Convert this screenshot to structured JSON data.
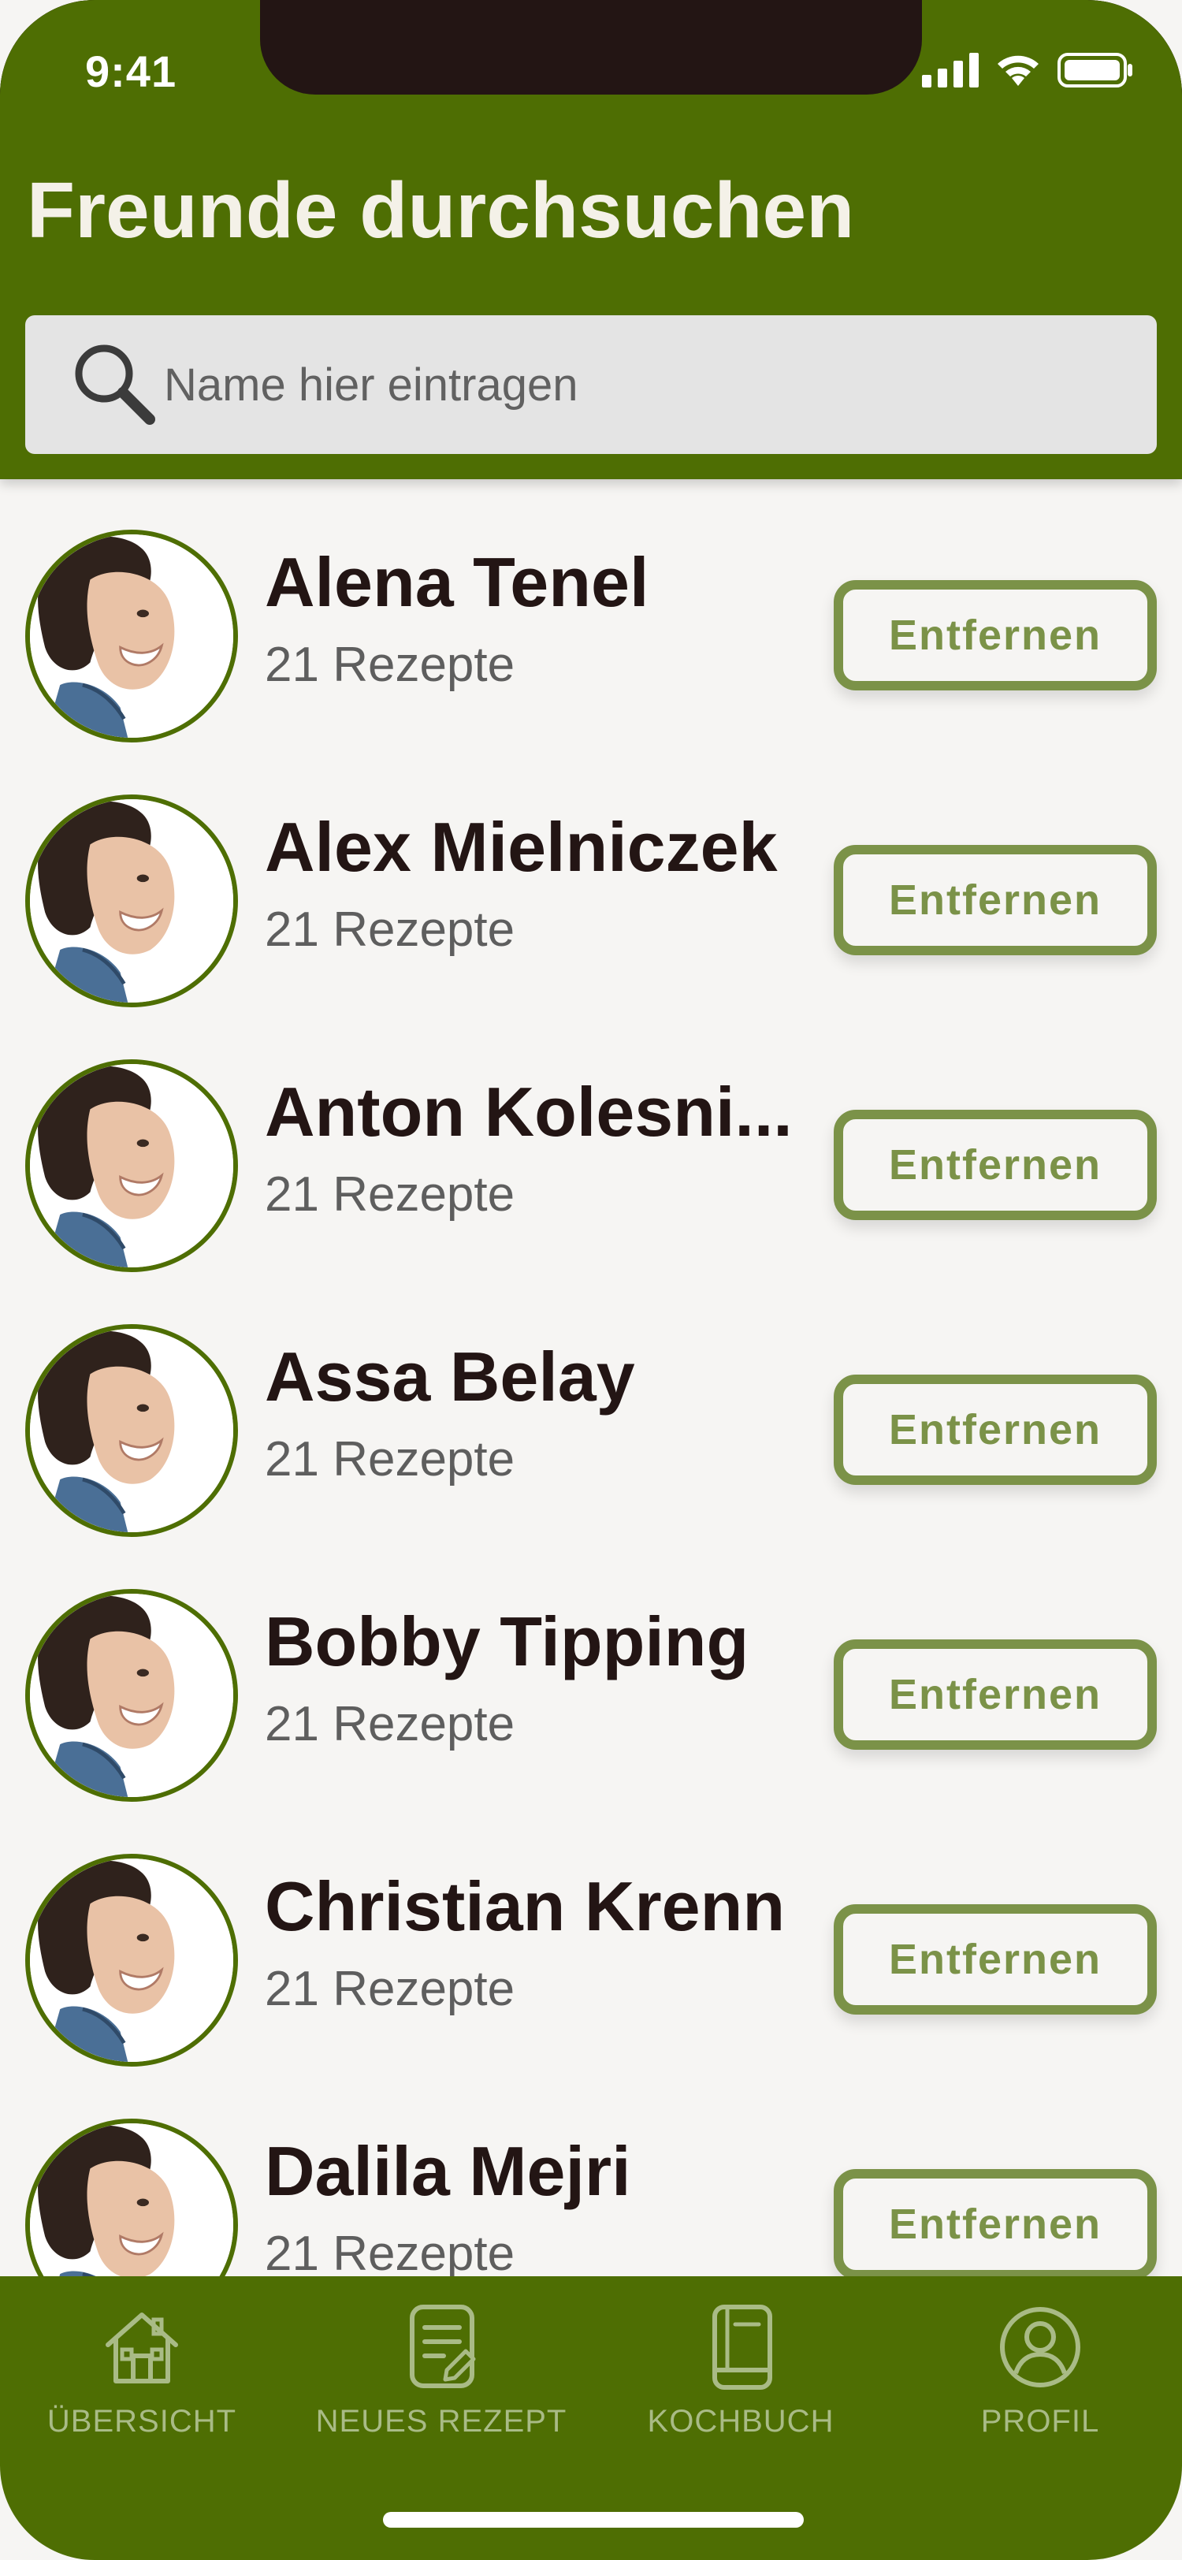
{
  "status_bar": {
    "time": "9:41"
  },
  "header": {
    "title": "Freunde durchsuchen"
  },
  "search": {
    "placeholder": "Name hier eintragen",
    "value": ""
  },
  "friends": [
    {
      "name": "Alena Tenel",
      "recipes": "21 Rezepte",
      "action": "Entfernen"
    },
    {
      "name": "Alex Mielniczek",
      "recipes": "21 Rezepte",
      "action": "Entfernen"
    },
    {
      "name": "Anton Kolesni...",
      "recipes": "21 Rezepte",
      "action": "Entfernen"
    },
    {
      "name": "Assa Belay",
      "recipes": "21 Rezepte",
      "action": "Entfernen"
    },
    {
      "name": "Bobby Tipping",
      "recipes": "21 Rezepte",
      "action": "Entfernen"
    },
    {
      "name": "Christian Krenn",
      "recipes": "21 Rezepte",
      "action": "Entfernen"
    },
    {
      "name": "Dalila Mejri",
      "recipes": "21 Rezepte",
      "action": "Entfernen"
    }
  ],
  "tab_bar": {
    "items": [
      {
        "label": "ÜBERSICHT",
        "icon": "house-icon"
      },
      {
        "label": "NEUES REZEPT",
        "icon": "note-edit-icon"
      },
      {
        "label": "KOCHBUCH",
        "icon": "book-icon"
      },
      {
        "label": "PROFIL",
        "icon": "profile-icon"
      }
    ]
  },
  "colors": {
    "brand_green": "#4e6e03",
    "button_green": "#7b9248",
    "tab_label": "#a9bb86",
    "background": "#f6f5f3",
    "text_dark": "#231514"
  }
}
